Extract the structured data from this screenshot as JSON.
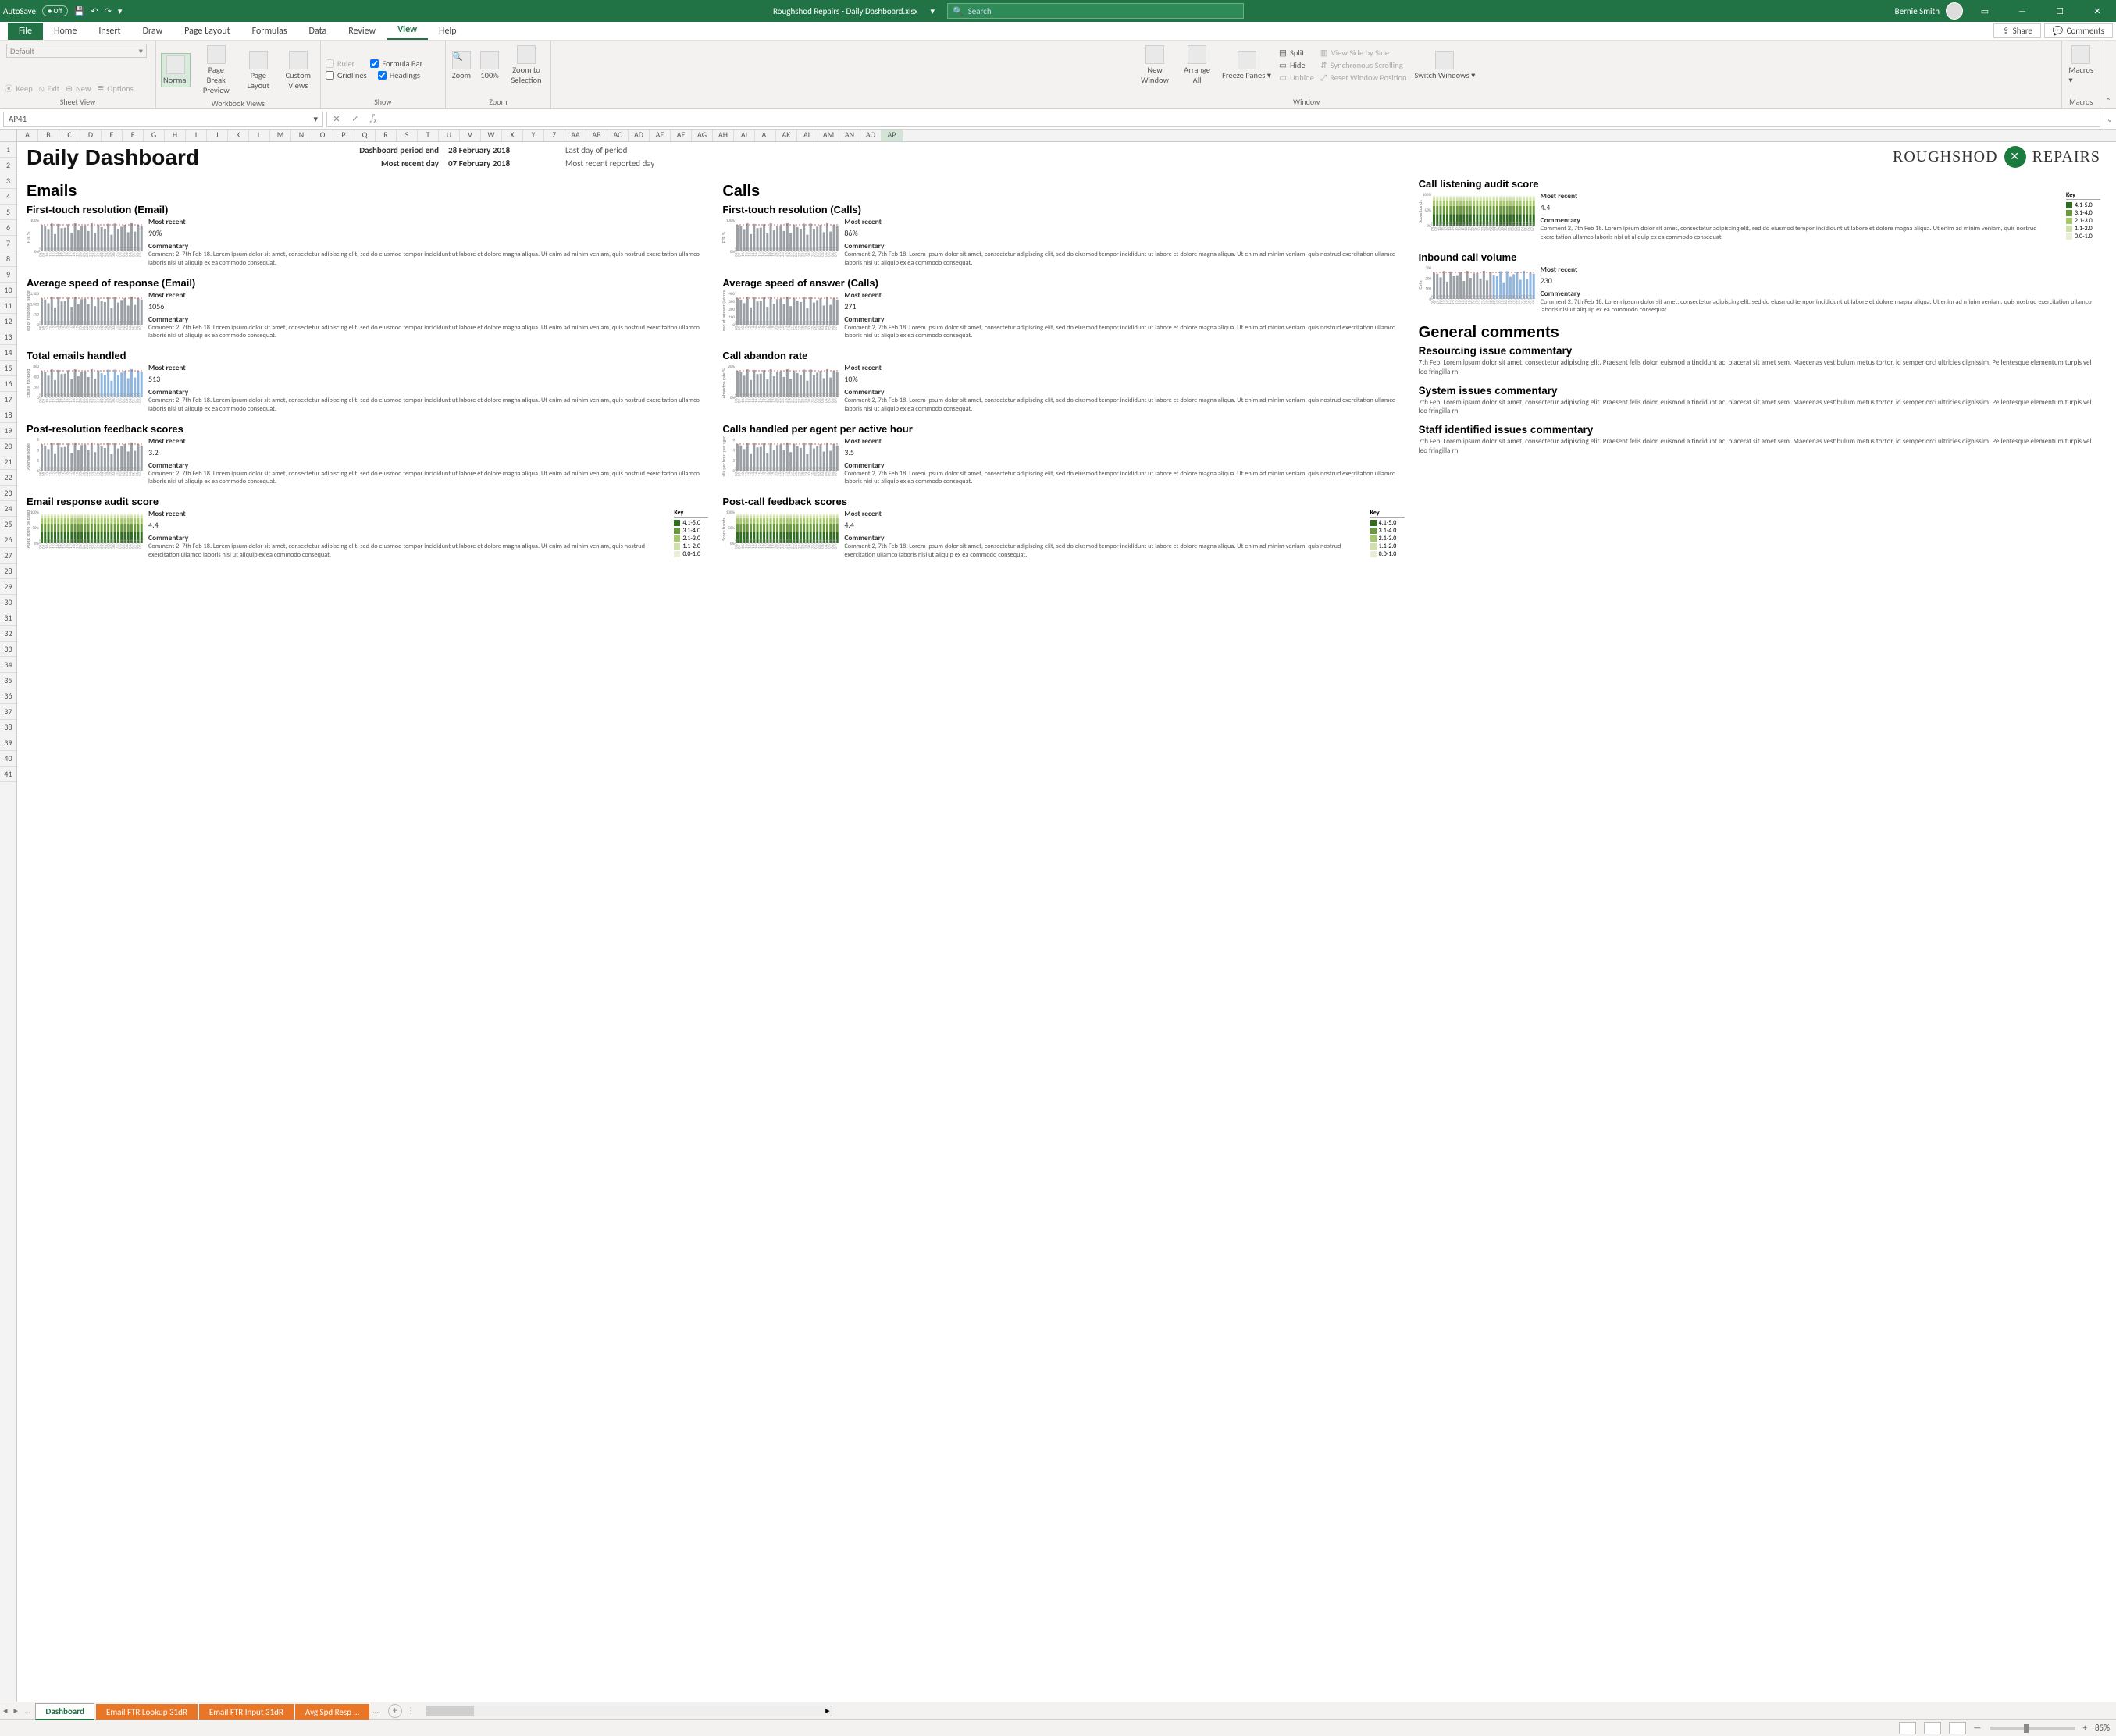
{
  "titlebar": {
    "autosave": "AutoSave",
    "filename": "Roughshod Repairs - Daily Dashboard.xlsx",
    "search_placeholder": "Search",
    "user": "Bernie Smith"
  },
  "menu": {
    "tabs": [
      "File",
      "Home",
      "Insert",
      "Draw",
      "Page Layout",
      "Formulas",
      "Data",
      "Review",
      "View",
      "Help"
    ],
    "active": "View",
    "share": "Share",
    "comments": "Comments"
  },
  "ribbon": {
    "sheet_view": {
      "label": "Sheet View",
      "default": "Default",
      "keep": "Keep",
      "exit": "Exit",
      "new": "New",
      "options": "Options"
    },
    "workbook_views": {
      "label": "Workbook Views",
      "normal": "Normal",
      "page_break": "Page Break Preview",
      "page_layout": "Page Layout",
      "custom": "Custom Views"
    },
    "show": {
      "label": "Show",
      "ruler": "Ruler",
      "formula_bar": "Formula Bar",
      "gridlines": "Gridlines",
      "headings": "Headings"
    },
    "zoom": {
      "label": "Zoom",
      "zoom": "Zoom",
      "z100": "100%",
      "zoom_sel": "Zoom to Selection"
    },
    "window": {
      "label": "Window",
      "new": "New Window",
      "arrange": "Arrange All",
      "freeze": "Freeze Panes",
      "split": "Split",
      "hide": "Hide",
      "unhide": "Unhide",
      "sbs": "View Side by Side",
      "sync": "Synchronous Scrolling",
      "reset": "Reset Window Position",
      "switch": "Switch Windows"
    },
    "macros": {
      "label": "Macros",
      "macros": "Macros"
    }
  },
  "formula_bar": {
    "cell_ref": "AP41"
  },
  "columns": [
    "A",
    "B",
    "C",
    "D",
    "E",
    "F",
    "G",
    "H",
    "I",
    "J",
    "K",
    "L",
    "M",
    "N",
    "O",
    "P",
    "Q",
    "R",
    "S",
    "T",
    "U",
    "V",
    "W",
    "X",
    "Y",
    "Z",
    "AA",
    "AB",
    "AC",
    "AD",
    "AE",
    "AF",
    "AG",
    "AH",
    "AI",
    "AJ",
    "AK",
    "AL",
    "AM",
    "AN",
    "AO",
    "AP"
  ],
  "rows": [
    1,
    2,
    3,
    4,
    5,
    6,
    7,
    8,
    9,
    10,
    11,
    12,
    13,
    14,
    15,
    16,
    17,
    18,
    19,
    20,
    21,
    22,
    23,
    24,
    25,
    26,
    27,
    28,
    29,
    30,
    31,
    32,
    33,
    34,
    35,
    36,
    37,
    38,
    39,
    40,
    41
  ],
  "dashboard": {
    "title": "Daily Dashboard",
    "period_end_lbl": "Dashboard period end",
    "period_end_val": "28 February 2018",
    "recent_lbl": "Most recent day",
    "recent_val": "07 February 2018",
    "period_end_desc": "Last day of period",
    "recent_desc": "Most recent reported day",
    "logo_a": "ROUGHSHOD",
    "logo_b": "REPAIRS",
    "sections": {
      "emails": "Emails",
      "calls": "Calls",
      "general": "General comments"
    },
    "common": {
      "most_recent": "Most recent",
      "commentary": "Commentary",
      "key": "Key"
    },
    "commentary_text": "Comment 2, 7th Feb 18. Lorem ipsum dolor sit amet, consectetur adipiscing elit, sed do eiusmod tempor incididunt ut labore et dolore magna aliqua. Ut enim ad minim veniam, quis nostrud exercitation ullamco laboris nisi ut aliquip ex ea commodo consequat.",
    "gc_text": "7th Feb. Lorem ipsum dolor sit amet, consectetur adipiscing elit. Praesent felis dolor, euismod a tincidunt ac, placerat sit amet sem. Maecenas vestibulum metus tortor, id semper orci ultricies dignissim. Pellentesque elementum turpis vel leo fringilla rh",
    "key_bands": [
      "4.1-5.0",
      "3.1-4.0",
      "2.1-3.0",
      "1.1-2.0",
      "0.0-1.0"
    ],
    "emails": [
      {
        "title": "First-touch resolution (Email)",
        "value": "90%",
        "ylabel": "FTR %",
        "ticks": [
          "100%",
          "0%"
        ]
      },
      {
        "title": "Average speed of response (Email)",
        "value": "1056",
        "ylabel": "Speed of response (seconds)",
        "ticks": [
          "1,500",
          "1,000",
          "500",
          "0"
        ]
      },
      {
        "title": "Total emails handled",
        "value": "513",
        "ylabel": "Emails handled",
        "ticks": [
          "800",
          "400",
          "200",
          "0"
        ],
        "two_tone": true
      },
      {
        "title": "Post-resolution feedback scores",
        "value": "3.2",
        "ylabel": "Average score",
        "ticks": [
          "5",
          "3",
          "1",
          "-1"
        ]
      },
      {
        "title": "Email response audit score",
        "value": "4.4",
        "ylabel": "Audit score by band",
        "ticks": [
          "100%",
          "50%",
          "0%"
        ],
        "stacked": true,
        "has_key": true
      }
    ],
    "calls": [
      {
        "title": "First-touch resolution (Calls)",
        "value": "86%",
        "ylabel": "FTR %",
        "ticks": [
          "100%",
          "0%"
        ]
      },
      {
        "title": "Average speed of answer (Calls)",
        "value": "271",
        "ylabel": "Speed of answer (seconds)",
        "ticks": [
          "400",
          "300",
          "200",
          "100",
          "0"
        ]
      },
      {
        "title": "Call abandon rate",
        "value": "10%",
        "ylabel": "Abandon rate %",
        "ticks": [
          "20%",
          "0%"
        ]
      },
      {
        "title": "Calls handled per agent per active hour",
        "value": "3.5",
        "ylabel": "Calls per hour per agent",
        "ticks": [
          "6",
          "4",
          "2",
          "0"
        ]
      },
      {
        "title": "Post-call feedback scores",
        "value": "4.4",
        "ylabel": "Score bands",
        "ticks": [
          "100%",
          "50%",
          "0%"
        ],
        "stacked": true,
        "has_key": true
      }
    ],
    "rightcol": [
      {
        "title": "Call listening audit score",
        "value": "4.4",
        "ylabel": "Score bands",
        "ticks": [
          "100%",
          "50%",
          "0%"
        ],
        "stacked": true,
        "has_key": true
      },
      {
        "title": "Inbound call volume",
        "value": "230",
        "ylabel": "Calls",
        "ticks": [
          "300",
          "200",
          "100",
          "0"
        ],
        "two_tone": true
      }
    ],
    "general_comments": [
      {
        "title": "Resourcing issue commentary"
      },
      {
        "title": "System issues commentary"
      },
      {
        "title": "Staff identified issues commentary"
      }
    ],
    "x_dates": [
      "08/01",
      "09",
      "10/01",
      "11/01",
      "12/01",
      "13/01",
      "14/01",
      "15/01",
      "16/01",
      "17/01",
      "18/01",
      "19/01",
      "20/01",
      "21/01",
      "22/01",
      "23/01",
      "24/01",
      "25/01",
      "26/01",
      "27/01",
      "28/01",
      "29/01",
      "30/01",
      "31/01",
      "01/02",
      "02/02",
      "03/02",
      "04/02",
      "05/02",
      "06/02",
      "07/02"
    ]
  },
  "chart_data": {
    "type": "bar",
    "note": "31 daily bars, x = 08/01 through 07/02. Values below are estimated from pixel heights against each panel's y-axis.",
    "categories": [
      "08/01",
      "09/01",
      "10/01",
      "11/01",
      "12/01",
      "13/01",
      "14/01",
      "15/01",
      "16/01",
      "17/01",
      "18/01",
      "19/01",
      "20/01",
      "21/01",
      "22/01",
      "23/01",
      "24/01",
      "25/01",
      "26/01",
      "27/01",
      "28/01",
      "29/01",
      "30/01",
      "31/01",
      "01/02",
      "02/02",
      "03/02",
      "04/02",
      "05/02",
      "06/02",
      "07/02"
    ],
    "panels": {
      "ftr_email": {
        "ylim": [
          0,
          100
        ],
        "target": 85,
        "values": [
          88,
          80,
          90,
          92,
          85,
          82,
          89,
          86,
          90,
          84,
          88,
          91,
          86,
          83,
          88,
          90,
          87,
          89,
          85,
          84,
          90,
          92,
          86,
          84,
          88,
          90,
          85,
          87,
          89,
          84,
          90
        ]
      },
      "ftr_calls": {
        "ylim": [
          0,
          100
        ],
        "target": 80,
        "values": [
          82,
          78,
          86,
          88,
          80,
          76,
          84,
          82,
          86,
          80,
          84,
          87,
          82,
          79,
          84,
          86,
          83,
          85,
          81,
          80,
          86,
          88,
          82,
          80,
          84,
          86,
          81,
          83,
          85,
          80,
          86
        ]
      },
      "asr_email": {
        "ylim": [
          0,
          1500
        ],
        "target": 600,
        "values": [
          900,
          700,
          1100,
          1050,
          800,
          950,
          1000,
          850,
          1200,
          900,
          1050,
          1150,
          800,
          900,
          1000,
          1100,
          950,
          1050,
          900,
          850,
          1150,
          1000,
          950,
          900,
          1100,
          1050,
          900,
          1000,
          950,
          1100,
          1056
        ]
      },
      "asa_calls": {
        "ylim": [
          0,
          400
        ],
        "target": 150,
        "values": [
          250,
          180,
          300,
          280,
          200,
          260,
          290,
          220,
          320,
          240,
          280,
          310,
          210,
          230,
          270,
          300,
          250,
          290,
          230,
          210,
          320,
          280,
          260,
          240,
          300,
          290,
          220,
          270,
          250,
          300,
          271
        ]
      },
      "emails_handled": {
        "ylim": [
          0,
          800
        ],
        "target": 300,
        "values": [
          420,
          380,
          500,
          480,
          360,
          440,
          470,
          400,
          560,
          430,
          490,
          540,
          390,
          410,
          460,
          520,
          450,
          510,
          420,
          390,
          570,
          500,
          470,
          440,
          530,
          510,
          400,
          480,
          450,
          540,
          513
        ]
      },
      "abandon_rate": {
        "ylim": [
          0,
          20
        ],
        "target": 5,
        "values": [
          9,
          7,
          12,
          11,
          8,
          10,
          10,
          8,
          13,
          9,
          11,
          12,
          7,
          8,
          10,
          12,
          9,
          11,
          8,
          7,
          13,
          11,
          10,
          9,
          12,
          11,
          8,
          10,
          9,
          12,
          10
        ]
      },
      "post_res_fb": {
        "ylim": [
          -1,
          5
        ],
        "values": [
          3.4,
          2.9,
          3.6,
          3.5,
          3.0,
          3.3,
          3.4,
          2.8,
          3.7,
          3.1,
          3.5,
          3.6,
          2.9,
          3.0,
          3.3,
          3.5,
          3.2,
          3.4,
          3.0,
          2.8,
          3.7,
          3.5,
          3.3,
          3.1,
          3.6,
          3.5,
          2.9,
          3.3,
          3.1,
          3.6,
          3.2
        ]
      },
      "calls_per_hour": {
        "ylim": [
          0,
          6
        ],
        "target": 4,
        "values": [
          3.4,
          3.0,
          4.0,
          3.8,
          3.1,
          3.5,
          3.7,
          3.2,
          4.2,
          3.3,
          3.8,
          4.0,
          3.0,
          3.1,
          3.5,
          3.9,
          3.4,
          3.8,
          3.2,
          3.0,
          4.2,
          3.9,
          3.6,
          3.4,
          4.0,
          3.9,
          3.1,
          3.6,
          3.4,
          4.0,
          3.5
        ]
      },
      "inbound_volume": {
        "ylim": [
          0,
          300
        ],
        "values": [
          240,
          210,
          260,
          255,
          200,
          245,
          250,
          215,
          280,
          225,
          255,
          270,
          200,
          210,
          240,
          265,
          235,
          260,
          215,
          205,
          285,
          260,
          245,
          225,
          270,
          260,
          210,
          250,
          230,
          270,
          230
        ]
      },
      "audit_score_bands": {
        "type": "stacked",
        "ylim": [
          0,
          100
        ],
        "bands": [
          "4.1-5.0",
          "3.1-4.0",
          "2.1-3.0",
          "1.1-2.0",
          "0.0-1.0"
        ],
        "note": "percent of audits in each band; same pattern reused across the three audit panels"
      }
    }
  },
  "sheet_tabs": {
    "active": "Dashboard",
    "tabs": [
      "Dashboard",
      "Email FTR Lookup 31dR",
      "Email FTR Input 31dR",
      "Avg Spd Resp …"
    ],
    "more": "..."
  },
  "statusbar": {
    "zoom": "85%"
  }
}
